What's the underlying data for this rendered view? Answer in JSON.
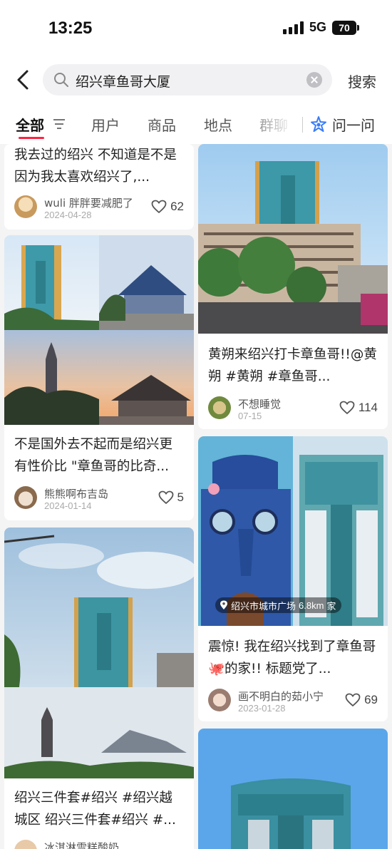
{
  "status_bar": {
    "time": "13:25",
    "network": "5G",
    "battery": "70"
  },
  "header": {
    "search_query": "绍兴章鱼哥大厦",
    "search_button": "搜索"
  },
  "tabs": {
    "items": [
      "全部",
      "用户",
      "商品",
      "地点",
      "群聊"
    ],
    "ask_label": "问一问"
  },
  "cards": [
    {
      "title": "我去过的绍兴 不知道是不是因为我太喜欢绍兴了,...",
      "author": "wuli 胖胖要减肥了",
      "date": "2024-04-28",
      "likes": "62"
    },
    {
      "title": "黄朔来绍兴打卡章鱼哥!!@黄朔 #黄朔 #章鱼哥...",
      "author": "不想睡觉",
      "date": "07-15",
      "likes": "114"
    },
    {
      "title": "不是国外去不起而是绍兴更有性价比 \"章鱼哥的比奇...",
      "author": "熊熊啊布吉岛",
      "date": "2024-01-14",
      "likes": "5"
    },
    {
      "title": "震惊! 我在绍兴找到了章鱼哥🐙的家!! 标题党了...",
      "author": "画不明白的茹小宁",
      "date": "2023-01-28",
      "likes": "69",
      "location_tag": "绍兴市城市广场",
      "location_distance": "6.8km",
      "location_suffix": "家"
    },
    {
      "title": "绍兴三件套#绍兴 #绍兴越城区 绍兴三件套#绍兴 #...",
      "author": "冰淇淋雪糕酸奶"
    }
  ],
  "colors": {
    "accent": "#ff2442",
    "ask_blue": "#3b7cf6"
  }
}
